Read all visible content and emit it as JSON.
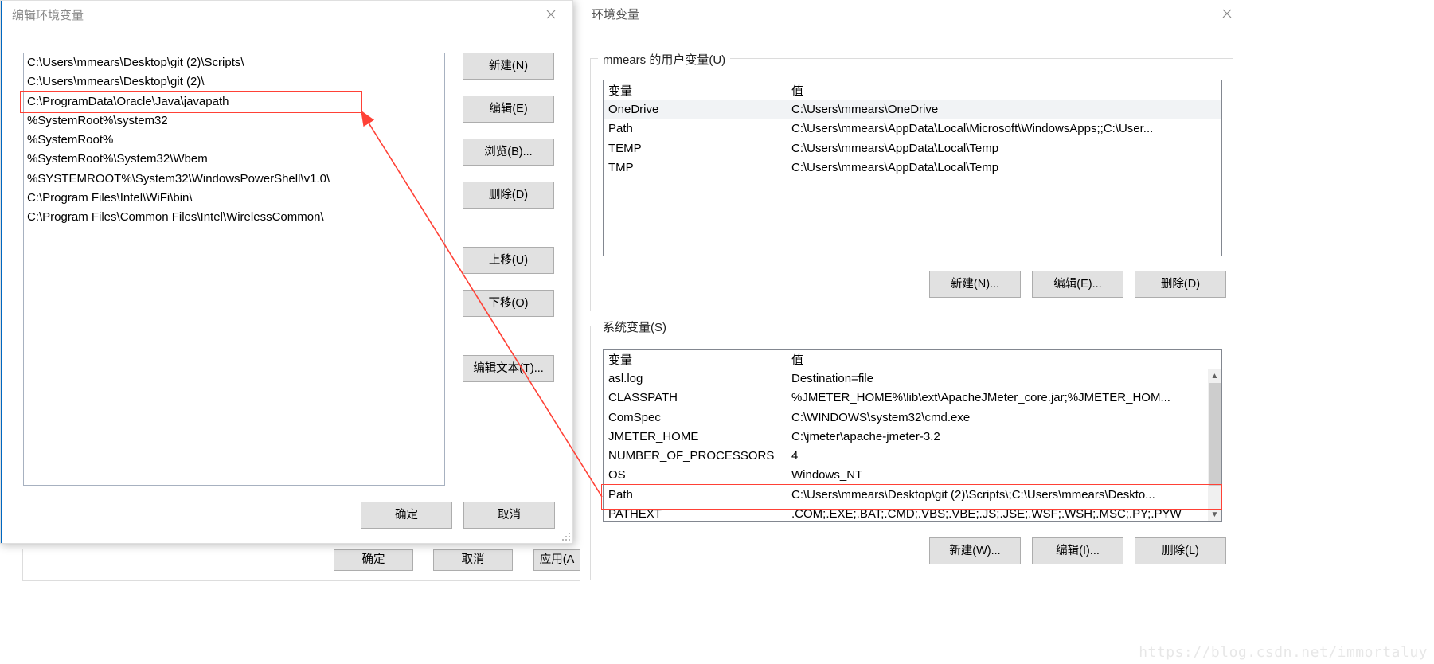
{
  "editWindow": {
    "title": "编辑环境变量",
    "paths": [
      "C:\\Users\\mmears\\Desktop\\git (2)\\Scripts\\",
      "C:\\Users\\mmears\\Desktop\\git (2)\\",
      "C:\\ProgramData\\Oracle\\Java\\javapath",
      "%SystemRoot%\\system32",
      "%SystemRoot%",
      "%SystemRoot%\\System32\\Wbem",
      "%SYSTEMROOT%\\System32\\WindowsPowerShell\\v1.0\\",
      "C:\\Program Files\\Intel\\WiFi\\bin\\",
      "C:\\Program Files\\Common Files\\Intel\\WirelessCommon\\"
    ],
    "buttons": {
      "new": "新建(N)",
      "edit": "编辑(E)",
      "browse": "浏览(B)...",
      "delete": "删除(D)",
      "moveUp": "上移(U)",
      "moveDown": "下移(O)",
      "editText": "编辑文本(T)...",
      "ok": "确定",
      "cancel": "取消"
    }
  },
  "envWindow": {
    "title": "环境变量",
    "userLabel": "mmears 的用户变量(U)",
    "sysLabel": "系统变量(S)",
    "colVar": "变量",
    "colVal": "值",
    "userVars": [
      {
        "name": "OneDrive",
        "value": "C:\\Users\\mmears\\OneDrive"
      },
      {
        "name": "Path",
        "value": "C:\\Users\\mmears\\AppData\\Local\\Microsoft\\WindowsApps;;C:\\User..."
      },
      {
        "name": "TEMP",
        "value": "C:\\Users\\mmears\\AppData\\Local\\Temp"
      },
      {
        "name": "TMP",
        "value": "C:\\Users\\mmears\\AppData\\Local\\Temp"
      }
    ],
    "sysVars": [
      {
        "name": "asl.log",
        "value": "Destination=file"
      },
      {
        "name": "CLASSPATH",
        "value": "%JMETER_HOME%\\lib\\ext\\ApacheJMeter_core.jar;%JMETER_HOM..."
      },
      {
        "name": "ComSpec",
        "value": "C:\\WINDOWS\\system32\\cmd.exe"
      },
      {
        "name": "JMETER_HOME",
        "value": "C:\\jmeter\\apache-jmeter-3.2"
      },
      {
        "name": "NUMBER_OF_PROCESSORS",
        "value": "4"
      },
      {
        "name": "OS",
        "value": "Windows_NT"
      },
      {
        "name": "Path",
        "value": "C:\\Users\\mmears\\Desktop\\git (2)\\Scripts\\;C:\\Users\\mmears\\Deskto..."
      },
      {
        "name": "PATHEXT",
        "value": ".COM;.EXE;.BAT;.CMD;.VBS;.VBE;.JS;.JSE;.WSF;.WSH;.MSC;.PY;.PYW"
      }
    ],
    "buttons": {
      "newUser": "新建(N)...",
      "editUser": "编辑(E)...",
      "deleteUser": "删除(D)",
      "newSys": "新建(W)...",
      "editSys": "编辑(I)...",
      "deleteSys": "删除(L)"
    }
  },
  "parentButtons": {
    "ok": "确定",
    "cancel": "取消",
    "apply": "应用(A"
  },
  "watermark": "https://blog.csdn.net/immortaluy"
}
